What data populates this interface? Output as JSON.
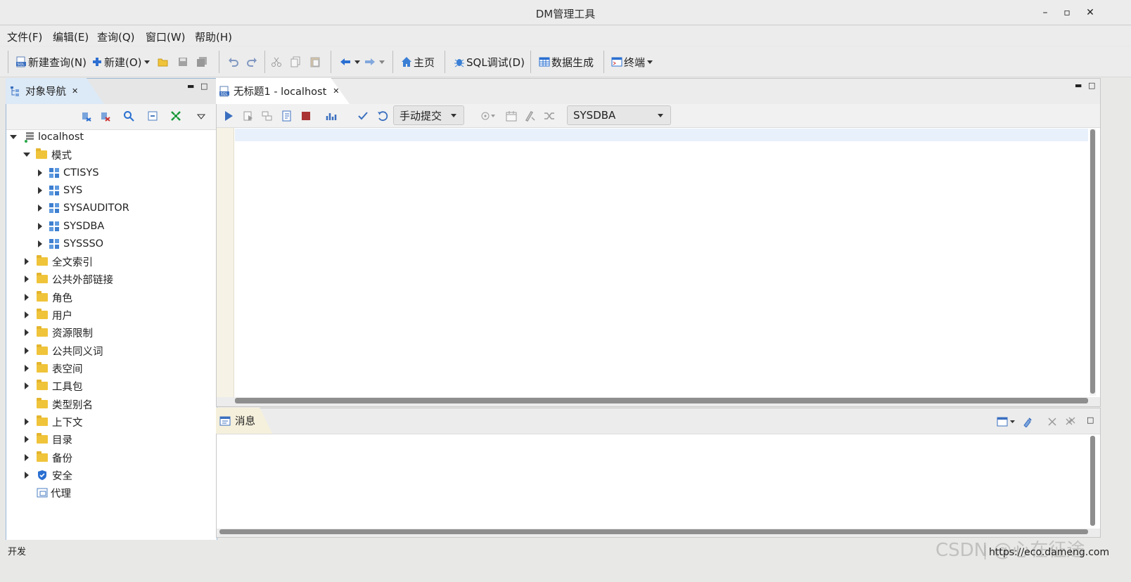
{
  "window": {
    "title": "DM管理工具",
    "min": "–",
    "max": "▫",
    "close": "✕"
  },
  "menu": [
    {
      "label": "文件(F)"
    },
    {
      "label": "编辑(E)"
    },
    {
      "label": "查询(Q)"
    },
    {
      "label": "窗口(W)"
    },
    {
      "label": "帮助(H)"
    }
  ],
  "toolbar": {
    "new_query": "新建查询(N)",
    "new_obj": "新建(O)",
    "home": "主页",
    "sql_debug": "SQL调试(D)",
    "data_gen": "数据生成",
    "terminal": "终端"
  },
  "nav": {
    "tab_label": "对象导航",
    "close": "✕",
    "tree": {
      "root": "localhost",
      "schema_folder": "模式",
      "schemas": [
        "CTISYS",
        "SYS",
        "SYSAUDITOR",
        "SYSDBA",
        "SYSSSO"
      ],
      "folders": [
        "全文索引",
        "公共外部链接",
        "角色",
        "用户",
        "资源限制",
        "公共同义词",
        "表空间",
        "工具包",
        "类型别名",
        "上下文",
        "目录",
        "备份",
        "安全",
        "代理"
      ]
    }
  },
  "editor": {
    "tab_label": "无标题1 - localhost",
    "close": "✕",
    "commit_mode": "手动提交",
    "schema_select": "SYSDBA"
  },
  "messages": {
    "tab_label": "消息"
  },
  "status": {
    "text": "开发",
    "watermark": "CSDN @心在征途",
    "url": "https://eco.dameng.com"
  }
}
